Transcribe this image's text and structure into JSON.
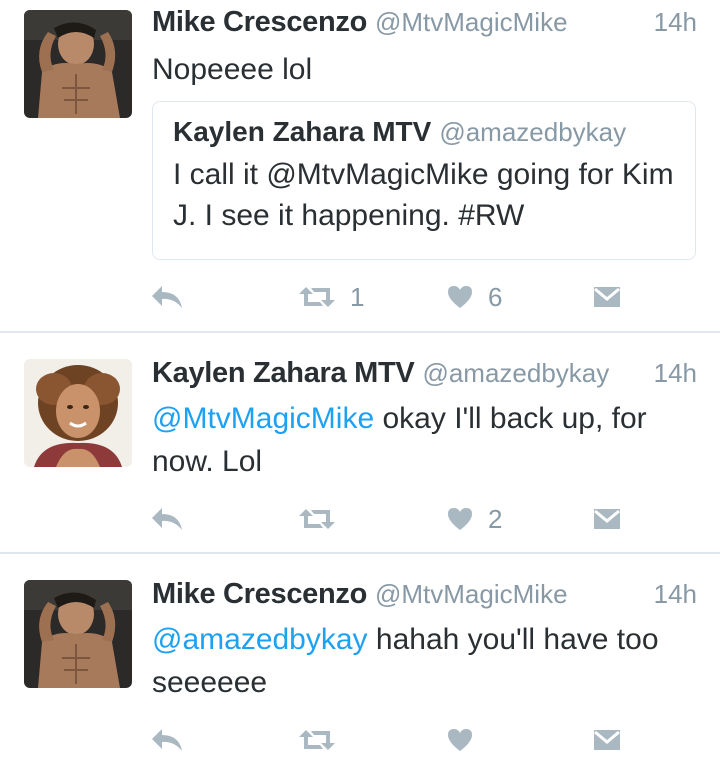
{
  "tweets": [
    {
      "name": "Mike Crescenzo",
      "handle": "@MtvMagicMike",
      "time": "14h",
      "text": "Nopeeee lol",
      "quote": {
        "name": "Kaylen Zahara MTV",
        "handle": "@amazedbykay",
        "text": "I call it @MtvMagicMike going for Kim J. I see it happening. #RW"
      },
      "retweets": "1",
      "likes": "6"
    },
    {
      "name": "Kaylen Zahara MTV",
      "handle": "@amazedbykay",
      "time": "14h",
      "mention": "@MtvMagicMike",
      "text": " okay I'll back up, for now. Lol",
      "retweets": "",
      "likes": "2"
    },
    {
      "name": "Mike Crescenzo",
      "handle": "@MtvMagicMike",
      "time": "14h",
      "mention": "@amazedbykay",
      "text": " hahah you'll have too seeeeee",
      "retweets": "",
      "likes": ""
    }
  ],
  "icons": {
    "reply": "reply-icon",
    "retweet": "retweet-icon",
    "like": "heart-icon",
    "message": "direct-message-icon"
  },
  "colors": {
    "link": "#1da1f2",
    "icon": "#aab8c2",
    "muted": "#8899a6",
    "divider": "#e1e8ed"
  }
}
